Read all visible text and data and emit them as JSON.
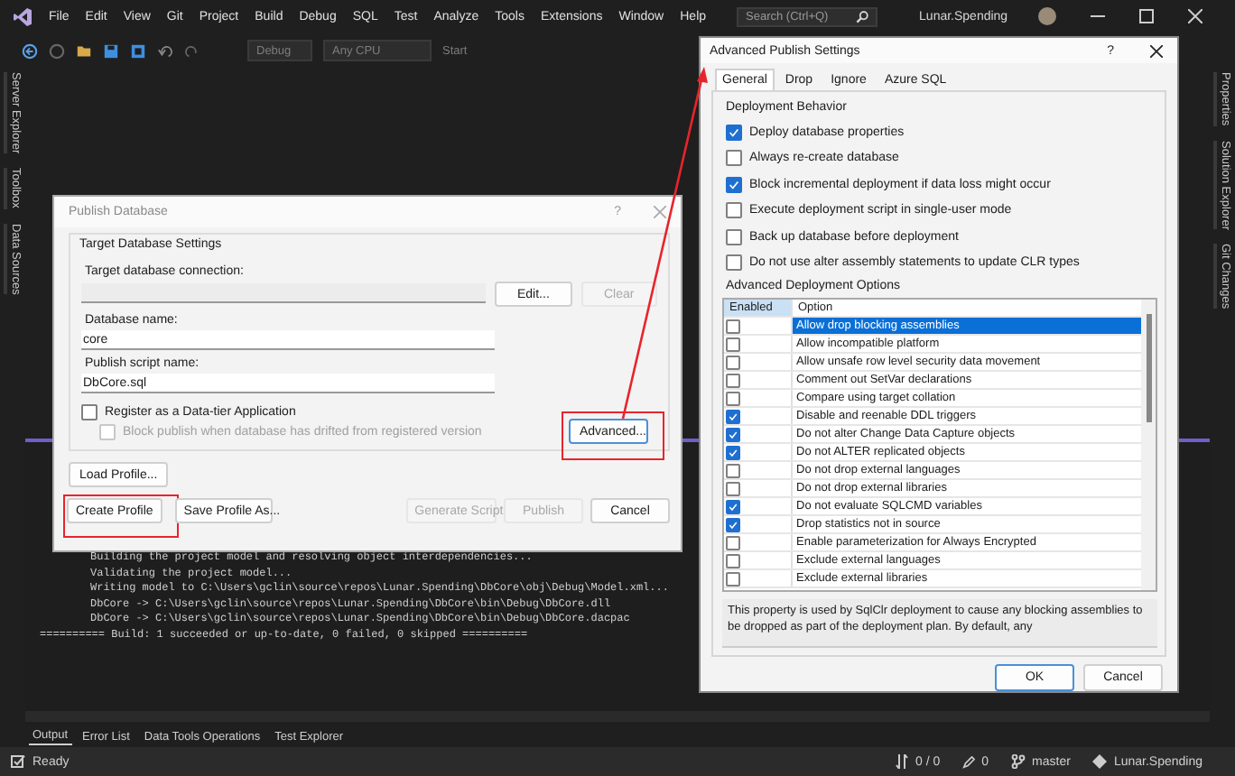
{
  "menu_bar": {
    "items": [
      "File",
      "Edit",
      "View",
      "Git",
      "Project",
      "Build",
      "Debug",
      "SQL",
      "Test",
      "Analyze",
      "Tools",
      "Extensions",
      "Window",
      "Help"
    ],
    "search": {
      "placeholder": "Search (Ctrl+Q)"
    },
    "solution_name": "Lunar.Spending"
  },
  "toolbar": {
    "configuration": "Debug",
    "platform": "Any CPU",
    "start": "Start"
  },
  "left_rail": [
    "Server Explorer",
    "Toolbox",
    "Data Sources"
  ],
  "right_rail": [
    "Properties",
    "Solution Explorer",
    "Git Changes"
  ],
  "output": {
    "lines": [
      {
        "kind": "detail",
        "text": "Building the project model and resolving object interdependencies..."
      },
      {
        "kind": "detail",
        "text": "Validating the project model..."
      },
      {
        "kind": "detail",
        "text": "Writing model to C:\\Users\\gclin\\source\\repos\\Lunar.Spending\\DbCore\\obj\\Debug\\Model.xml..."
      },
      {
        "kind": "detail",
        "text": "DbCore -> C:\\Users\\gclin\\source\\repos\\Lunar.Spending\\DbCore\\bin\\Debug\\DbCore.dll"
      },
      {
        "kind": "detail",
        "text": "DbCore -> C:\\Users\\gclin\\source\\repos\\Lunar.Spending\\DbCore\\bin\\Debug\\DbCore.dacpac"
      },
      {
        "kind": "summary",
        "text": "========== Build: 1 succeeded or up-to-date, 0 failed, 0 skipped =========="
      }
    ]
  },
  "bottom_tabs": [
    {
      "label": "Output",
      "selected": true
    },
    {
      "label": "Error List",
      "selected": false
    },
    {
      "label": "Data Tools Operations",
      "selected": false
    },
    {
      "label": "Test Explorer",
      "selected": false
    }
  ],
  "status_bar": {
    "state": "Ready",
    "changes": "0 / 0",
    "edits": "0",
    "branch": "master",
    "repository": "Lunar.Spending"
  },
  "publish_dialog": {
    "title": "Publish Database",
    "help": "?",
    "group_title": "Target Database Settings",
    "connection_label": "Target database connection:",
    "edit_button": {
      "label": "Edit...",
      "disabled": false
    },
    "clear_button": {
      "label": "Clear",
      "disabled": true
    },
    "database_label": "Database name:",
    "database_value": "core",
    "script_label": "Publish script name:",
    "script_value": "DbCore.sql",
    "checkboxes": [
      {
        "label": "Register as a Data-tier Application",
        "checked": false,
        "disabled": false
      },
      {
        "label": "Block publish when database has drifted from registered version",
        "checked": false,
        "disabled": true
      }
    ],
    "advanced_button": "Advanced...",
    "load_button": "Load Profile...",
    "buttons": [
      {
        "label": "Create Profile",
        "disabled": false
      },
      {
        "label": "Save Profile As...",
        "disabled": false
      },
      {
        "label": "Generate Script",
        "disabled": true
      },
      {
        "label": "Publish",
        "disabled": true
      },
      {
        "label": "Cancel",
        "disabled": false
      }
    ]
  },
  "advanced_dialog": {
    "title": "Advanced Publish Settings",
    "help": "?",
    "tabs": [
      {
        "label": "General",
        "selected": true
      },
      {
        "label": "Drop",
        "selected": false
      },
      {
        "label": "Ignore",
        "selected": false
      },
      {
        "label": "Azure SQL",
        "selected": false
      }
    ],
    "behavior_title": "Deployment Behavior",
    "behavior": [
      {
        "label": "Deploy database properties",
        "checked": true
      },
      {
        "label": "Always re-create database",
        "checked": false
      },
      {
        "label": "Block incremental deployment if data loss might occur",
        "checked": true
      },
      {
        "label": "Execute deployment script in single-user mode",
        "checked": false
      },
      {
        "label": "Back up database before deployment",
        "checked": false
      },
      {
        "label": "Do not use alter assembly statements to update CLR types",
        "checked": false
      }
    ],
    "options_title": "Advanced Deployment Options",
    "columns": [
      "Enabled",
      "Option"
    ],
    "options": [
      {
        "label": "Allow drop blocking assemblies",
        "checked": false,
        "selected": true
      },
      {
        "label": "Allow incompatible platform",
        "checked": false,
        "selected": false
      },
      {
        "label": "Allow unsafe row level security data movement",
        "checked": false,
        "selected": false
      },
      {
        "label": "Comment out SetVar declarations",
        "checked": false,
        "selected": false
      },
      {
        "label": "Compare using target collation",
        "checked": false,
        "selected": false
      },
      {
        "label": "Disable and reenable DDL triggers",
        "checked": true,
        "selected": false
      },
      {
        "label": "Do not alter Change Data Capture objects",
        "checked": true,
        "selected": false
      },
      {
        "label": "Do not ALTER replicated objects",
        "checked": true,
        "selected": false
      },
      {
        "label": "Do not drop external languages",
        "checked": false,
        "selected": false
      },
      {
        "label": "Do not drop external libraries",
        "checked": false,
        "selected": false
      },
      {
        "label": "Do not evaluate SQLCMD variables",
        "checked": true,
        "selected": false
      },
      {
        "label": "Drop statistics not in source",
        "checked": true,
        "selected": false
      },
      {
        "label": "Enable parameterization for Always Encrypted",
        "checked": false,
        "selected": false
      },
      {
        "label": "Exclude external languages",
        "checked": false,
        "selected": false
      },
      {
        "label": "Exclude external libraries",
        "checked": false,
        "selected": false
      }
    ],
    "description": "This property is used by SqlClr deployment to cause any blocking assemblies to be dropped as part of the deployment plan. By default, any",
    "buttons": [
      "OK",
      "Cancel"
    ]
  }
}
